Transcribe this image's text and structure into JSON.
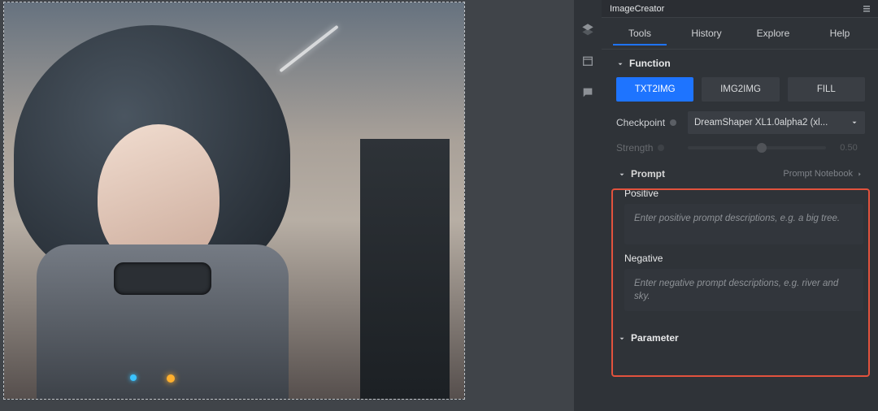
{
  "panel": {
    "title": "ImageCreator"
  },
  "tabs": [
    "Tools",
    "History",
    "Explore",
    "Help"
  ],
  "active_tab_index": 0,
  "function": {
    "title": "Function",
    "modes": [
      "TXT2IMG",
      "IMG2IMG",
      "FILL"
    ],
    "active_mode_index": 0,
    "checkpoint_label": "Checkpoint",
    "checkpoint_value": "DreamShaper XL1.0alpha2 (xl...",
    "strength_label": "Strength",
    "strength_value": "0.50"
  },
  "prompt": {
    "title": "Prompt",
    "notebook": "Prompt Notebook",
    "positive_label": "Positive",
    "positive_placeholder": "Enter positive prompt descriptions, e.g. a big tree.",
    "negative_label": "Negative",
    "negative_placeholder": "Enter negative prompt descriptions, e.g. river and sky."
  },
  "parameter": {
    "title": "Parameter"
  },
  "strip_icons": [
    "layers-icon",
    "calendar-icon",
    "chat-icon"
  ],
  "colors": {
    "accent": "#1e74ff",
    "highlight": "#e2523d",
    "bg": "#2f3338"
  }
}
